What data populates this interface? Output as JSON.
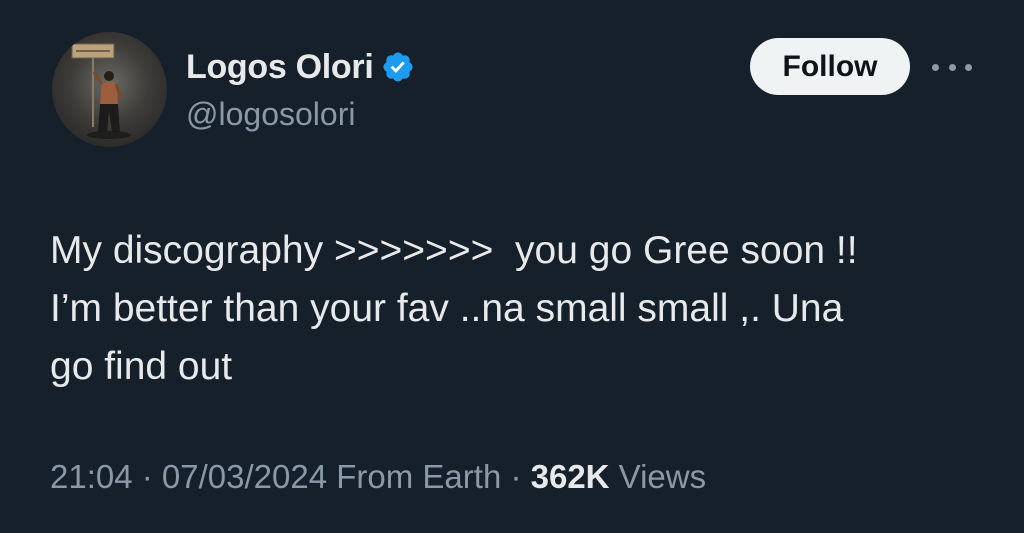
{
  "author": {
    "display_name": "Logos Olori",
    "handle": "@logosolori",
    "avatar_description_icon": "profile-photo",
    "verified_icon": "verified-badge-icon",
    "verified_color": "#1d9bf0"
  },
  "actions": {
    "follow_label": "Follow",
    "more_icon": "more-options-icon"
  },
  "tweet": {
    "lines": [
      "My discography >>>>>>>  you go Gree soon !!",
      "I’m better than your fav ..na small small ,. Una",
      "go find out"
    ]
  },
  "meta": {
    "time": "21:04",
    "separator": " · ",
    "date": "07/03/2024",
    "source": " From Earth",
    "views_count": "362K",
    "views_label": " Views"
  },
  "colors": {
    "background": "#16202b",
    "primary_text": "#e7e9ea",
    "secondary_text": "#8b98a5",
    "follow_button_bg": "#eff3f4"
  }
}
